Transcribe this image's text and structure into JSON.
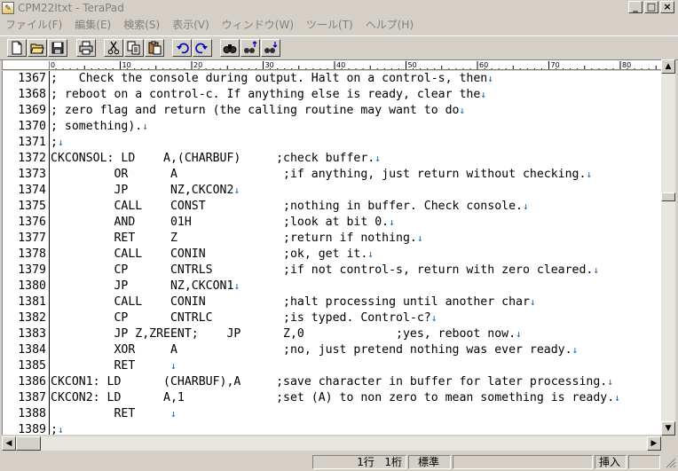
{
  "window": {
    "title": "CPM22Itxt - TeraPad",
    "minimize_label": "_",
    "maximize_label": "□",
    "close_label": "×"
  },
  "menu": [
    "ファイル(F)",
    "編集(E)",
    "検索(S)",
    "表示(V)",
    "ウィンドウ(W)",
    "ツール(T)",
    "ヘルプ(H)"
  ],
  "toolbar": [
    "new-file-icon",
    "open-folder-icon",
    "save-icon",
    "print-icon",
    "cut-icon",
    "copy-icon",
    "paste-icon",
    "undo-icon",
    "redo-icon",
    "find-icon",
    "find-prev-icon",
    "find-next-icon"
  ],
  "ruler": {
    "labels": [
      "0",
      "10",
      "20",
      "30",
      "40",
      "50",
      "60",
      "70",
      "80"
    ]
  },
  "editor": {
    "eol_mark": "↓",
    "lines": [
      {
        "num": "1367",
        "text": ";   Check the console during output. Halt on a control-s, then",
        "eol": true
      },
      {
        "num": "1368",
        "text": "; reboot on a control-c. If anything else is ready, clear the",
        "eol": true
      },
      {
        "num": "1369",
        "text": "; zero flag and return (the calling routine may want to do",
        "eol": true
      },
      {
        "num": "1370",
        "text": "; something).",
        "eol": true
      },
      {
        "num": "1371",
        "text": ";",
        "eol": true
      },
      {
        "num": "1372",
        "text": "CKCONSOL: LD    A,(CHARBUF)     ;check buffer.",
        "eol": true
      },
      {
        "num": "1373",
        "text": "         OR      A               ;if anything, just return without checking.",
        "eol": true
      },
      {
        "num": "1374",
        "text": "         JP      NZ,CKCON2",
        "eol": true
      },
      {
        "num": "1375",
        "text": "         CALL    CONST           ;nothing in buffer. Check console.",
        "eol": true
      },
      {
        "num": "1376",
        "text": "         AND     01H             ;look at bit 0.",
        "eol": true
      },
      {
        "num": "1377",
        "text": "         RET     Z               ;return if nothing.",
        "eol": true
      },
      {
        "num": "1378",
        "text": "         CALL    CONIN           ;ok, get it.",
        "eol": true
      },
      {
        "num": "1379",
        "text": "         CP      CNTRLS          ;if not control-s, return with zero cleared.",
        "eol": true
      },
      {
        "num": "1380",
        "text": "         JP      NZ,CKCON1",
        "eol": true
      },
      {
        "num": "1381",
        "text": "         CALL    CONIN           ;halt processing until another char",
        "eol": true
      },
      {
        "num": "1382",
        "text": "         CP      CNTRLC          ;is typed. Control-c?",
        "eol": true
      },
      {
        "num": "1383",
        "text": "         JP Z,ZREENT;    JP      Z,0             ;yes, reboot now.",
        "eol": true
      },
      {
        "num": "1384",
        "text": "         XOR     A               ;no, just pretend nothing was ever ready.",
        "eol": true
      },
      {
        "num": "1385",
        "text": "         RET     ",
        "eol": true
      },
      {
        "num": "1386",
        "text": "CKCON1: LD      (CHARBUF),A     ;save character in buffer for later processing.",
        "eol": true
      },
      {
        "num": "1387",
        "text": "CKCON2: LD      A,1             ;set (A) to non zero to mean something is ready.",
        "eol": true
      },
      {
        "num": "1388",
        "text": "         RET     ",
        "eol": true
      },
      {
        "num": "1389",
        "text": ";",
        "eol": true
      }
    ]
  },
  "status": {
    "line": "1行",
    "column": "1桁",
    "encoding": "標準",
    "insert_mode": "挿入"
  }
}
